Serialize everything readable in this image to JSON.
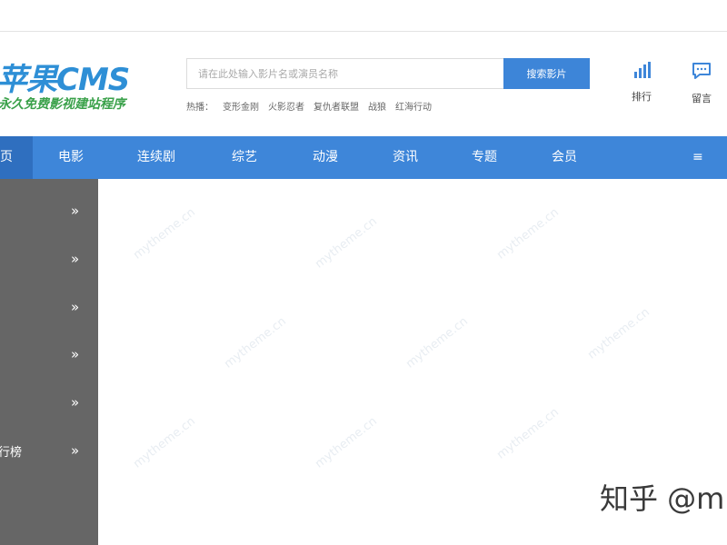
{
  "logo": {
    "title": "苹果CMS",
    "title_visible": "苹果CMS",
    "tagline": "永久免费影视建站程序"
  },
  "search": {
    "placeholder": "请在此处输入影片名或演员名称",
    "button_label": "搜索影片",
    "hot_label": "热播：",
    "hot_items": [
      "变形金刚",
      "火影忍者",
      "复仇者联盟",
      "战狼",
      "红海行动"
    ]
  },
  "tools": {
    "rank_label": "排行",
    "message_label": "留言"
  },
  "nav": {
    "home_label": "页",
    "items": [
      "电影",
      "连续剧",
      "综艺",
      "动漫",
      "资讯",
      "专题",
      "会员"
    ],
    "menu_label": "≡"
  },
  "sidebar": {
    "items": [
      {
        "label": "",
        "arrow": "»"
      },
      {
        "label": "",
        "arrow": "»"
      },
      {
        "label": "",
        "arrow": "»"
      },
      {
        "label": "",
        "arrow": "»"
      },
      {
        "label": "",
        "arrow": "»"
      },
      {
        "label": "行榜",
        "arrow": "»"
      }
    ]
  },
  "watermark": {
    "text": "mytheme.cn",
    "source": "知乎 @m"
  },
  "colors": {
    "nav": "#3e86d9",
    "nav_active": "#2f6fbf",
    "sidebar": "#666666",
    "logo_blue": "#2e8fd6",
    "logo_green": "#3aa14a"
  }
}
